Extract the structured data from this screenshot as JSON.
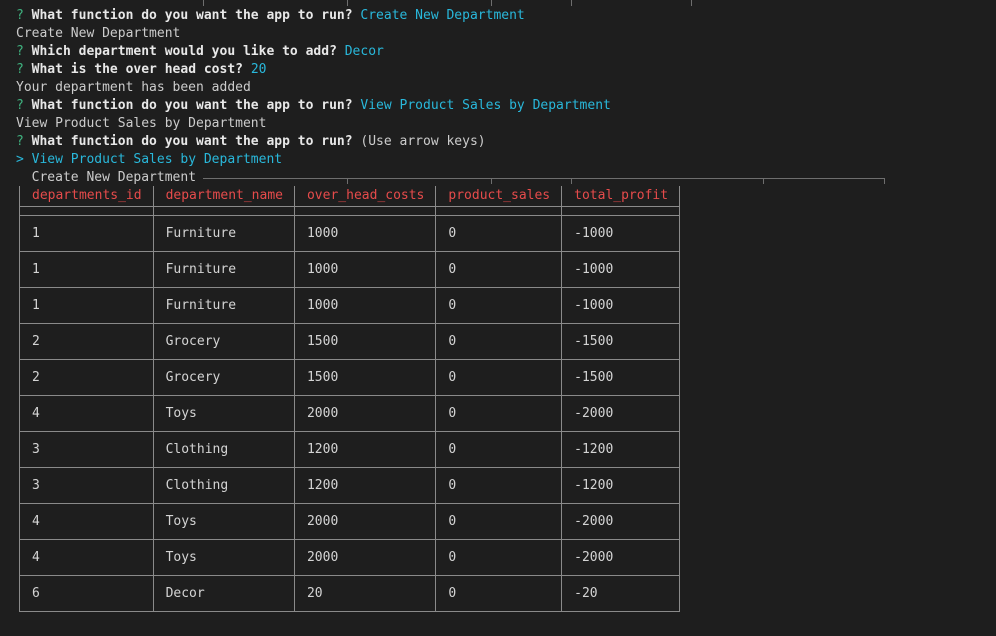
{
  "terminal": {
    "lines": [
      {
        "prompt_mark": "?",
        "question": "What function do you want the app to run?",
        "answer": "Create New Department"
      },
      {
        "output": "Create New Department"
      },
      {
        "prompt_mark": "?",
        "question": "Which department would you like to add?",
        "answer": "Decor"
      },
      {
        "prompt_mark": "?",
        "question": "What is the over head cost?",
        "answer": "20"
      },
      {
        "output": "Your department has been added"
      },
      {
        "prompt_mark": "?",
        "question": "What function do you want the app to run?",
        "answer": "View Product Sales by Department"
      },
      {
        "output": "View Product Sales by Department"
      },
      {
        "prompt_mark": "?",
        "question": "What function do you want the app to run?",
        "hint": "(Use arrow keys)"
      }
    ],
    "menu": {
      "selected_marker": ">",
      "selected": "View Product Sales by Department",
      "other": "Create New Department"
    }
  },
  "table": {
    "headers": [
      "departments_id",
      "department_name",
      "over_head_costs",
      "product_sales",
      "total_profit"
    ],
    "rows": [
      [
        "1",
        "Furniture",
        "1000",
        "0",
        "-1000"
      ],
      [
        "1",
        "Furniture",
        "1000",
        "0",
        "-1000"
      ],
      [
        "1",
        "Furniture",
        "1000",
        "0",
        "-1000"
      ],
      [
        "2",
        "Grocery",
        "1500",
        "0",
        "-1500"
      ],
      [
        "2",
        "Grocery",
        "1500",
        "0",
        "-1500"
      ],
      [
        "4",
        "Toys",
        "2000",
        "0",
        "-2000"
      ],
      [
        "3",
        "Clothing",
        "1200",
        "0",
        "-1200"
      ],
      [
        "3",
        "Clothing",
        "1200",
        "0",
        "-1200"
      ],
      [
        "4",
        "Toys",
        "2000",
        "0",
        "-2000"
      ],
      [
        "4",
        "Toys",
        "2000",
        "0",
        "-2000"
      ],
      [
        "6",
        "Decor",
        "20",
        "0",
        "-20"
      ]
    ]
  },
  "colors": {
    "background": "#1e1e1e",
    "prompt_mark": "#3fb27f",
    "answer": "#29b8db",
    "header": "#e64b4b",
    "text": "#cccccc"
  }
}
